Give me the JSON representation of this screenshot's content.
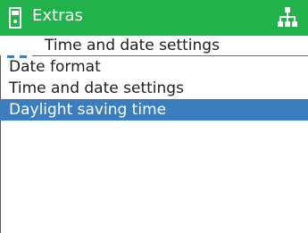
{
  "header": {
    "device_icon": "device-icon",
    "title": "Extras",
    "tree_icon": "sitemap-icon",
    "color": "#22b24c"
  },
  "breadcrumb": {
    "title": "Time and date settings"
  },
  "menu": {
    "items": [
      {
        "label": "Date format",
        "selected": false
      },
      {
        "label": "Time and date settings",
        "selected": false
      },
      {
        "label": "Daylight saving time",
        "selected": true
      }
    ],
    "selected_color": "#3a7ebf"
  }
}
